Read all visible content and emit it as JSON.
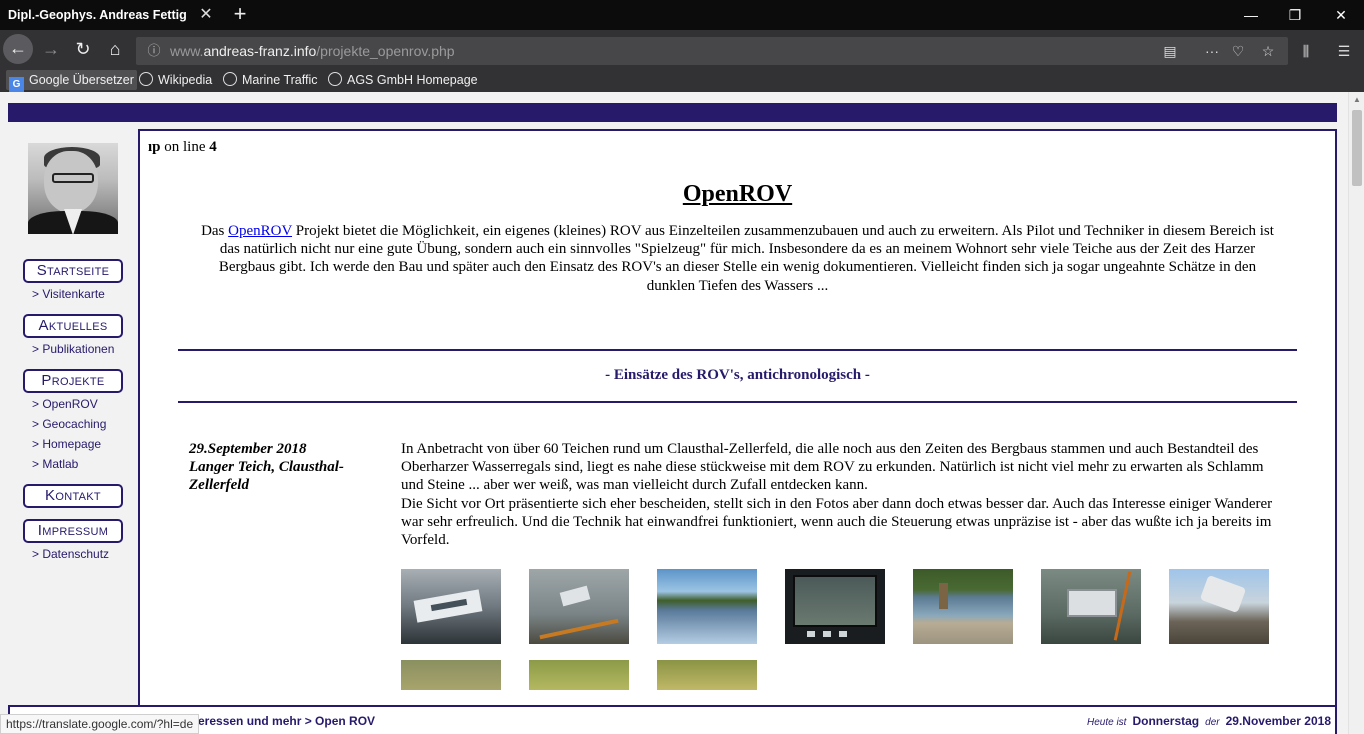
{
  "browser": {
    "tab_title": "Dipl.-Geophys. Andreas Fettig",
    "url_prefix": "www.",
    "url_host": "andreas-franz.info",
    "url_path": "/projekte_openrov.php",
    "bookmarks": [
      "Google Übersetzer",
      "Wikipedia",
      "Marine Traffic",
      "AGS GmbH Homepage"
    ],
    "status_url": "https://translate.google.com/?hl=de"
  },
  "sidebar": {
    "menu": [
      {
        "label": "Startseite",
        "sub": [
          "> Visitenkarte"
        ]
      },
      {
        "label": "Aktuelles",
        "sub": [
          "> Publikationen"
        ]
      },
      {
        "label": "Projekte",
        "sub": [
          "> OpenROV",
          "> Geocaching",
          "> Homepage",
          "> Matlab"
        ]
      },
      {
        "label": "Kontakt",
        "sub": []
      },
      {
        "label": "Impressum",
        "sub": [
          "> Datenschutz"
        ]
      }
    ]
  },
  "content": {
    "error_prefix": "ıp",
    "error_middle": " on line ",
    "error_line": "4",
    "title": "OpenROV",
    "intro_before": "Das ",
    "intro_link": "OpenROV",
    "intro_after": " Projekt bietet die Möglichkeit, ein eigenes (kleines) ROV aus Einzelteilen zusammenzubauen und auch zu erweitern. Als Pilot und Techniker in diesem Bereich ist das natürlich nicht nur eine gute Übung, sondern auch ein sinnvolles \"Spielzeug\" für mich. Insbesondere da es an meinem Wohnort sehr viele Teiche aus der Zeit des Harzer Bergbaus gibt. Ich werde den Bau und später auch den Einsatz des ROV's an dieser Stelle ein wenig dokumentieren. Vielleicht finden sich ja sogar ungeahnte Schätze in den dunklen Tiefen des Wassers ...",
    "section_heading": "- Einsätze des ROV's, antichronologisch -",
    "entry": {
      "date": "29.September 2018",
      "place": "Langer Teich, Clausthal-Zellerfeld",
      "text1": "In Anbetracht von über 60 Teichen rund um Clausthal-Zellerfeld, die alle noch aus den Zeiten des Bergbaus stammen und auch Bestandteil des Oberharzer Wasserregals sind, liegt es nahe diese stückweise mit dem ROV zu erkunden. Natürlich ist nicht viel mehr zu erwarten als Schlamm und Steine ... aber wer weiß, was man vielleicht durch Zufall entdecken kann.",
      "text2": "Die Sicht vor Ort präsentierte sich eher bescheiden, stellt sich in den Fotos aber dann doch etwas besser dar. Auch das Interesse einiger Wanderer war sehr erfreulich. Und die Technik hat einwandfrei funktioniert, wenn auch die Steuerung etwas unpräzise ist - aber das wußte ich ja bereits im Vorfeld."
    }
  },
  "footer": {
    "breadcrumb": "eressen und mehr > Open ROV",
    "heute": "Heute ist",
    "weekday": "Donnerstag",
    "der": "der",
    "date": "29.November 2018"
  },
  "colors": {
    "accent": "#271a6b",
    "link": "#0000ee"
  }
}
